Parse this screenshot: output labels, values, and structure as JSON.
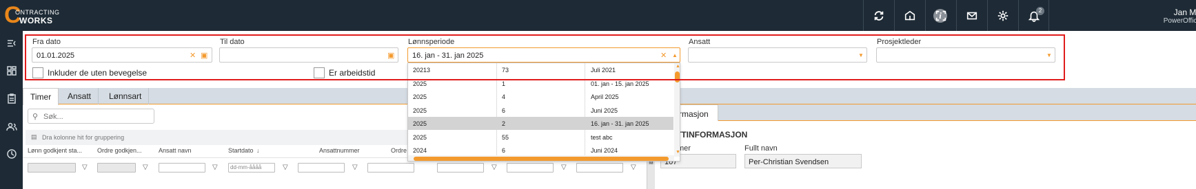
{
  "header": {
    "logo_top": "ONTRACTING",
    "logo_letter": "C",
    "logo_bottom": "WORKS",
    "info_icon": "i",
    "notification_count": "2",
    "user_name": "Jan Mo",
    "user_org": "PowerOffice",
    "icons": [
      "sync-icon",
      "book-icon",
      "fullscreen-icon",
      "mail-icon",
      "gear-icon",
      "bell-icon"
    ]
  },
  "sidebar": {
    "icons": [
      "menu-collapse-icon",
      "dashboard-icon",
      "clipboard-icon",
      "users-icon",
      "clock-icon"
    ]
  },
  "filters": {
    "fra_dato_label": "Fra dato",
    "fra_dato_value": "01.01.2025",
    "til_dato_label": "Til dato",
    "til_dato_value": "",
    "lonnsperiode_label": "Lønnsperiode",
    "lonnsperiode_value": "16. jan - 31. jan 2025",
    "ansatt_label": "Ansatt",
    "ansatt_value": "",
    "prosjektleder_label": "Prosjektleder",
    "prosjektleder_value": "",
    "include_label": "Inkluder de uten bevegelse",
    "arbeidstid_label": "Er arbeidstid"
  },
  "dropdown": {
    "rows": [
      {
        "year": "20213",
        "num": "73",
        "label": "Juli 2021",
        "selected": false
      },
      {
        "year": "2025",
        "num": "1",
        "label": "01. jan - 15. jan 2025",
        "selected": false
      },
      {
        "year": "2025",
        "num": "4",
        "label": "April 2025",
        "selected": false
      },
      {
        "year": "2025",
        "num": "6",
        "label": "Juni 2025",
        "selected": false
      },
      {
        "year": "2025",
        "num": "2",
        "label": "16. jan - 31. jan 2025",
        "selected": true
      },
      {
        "year": "2025",
        "num": "55",
        "label": "test abc",
        "selected": false
      },
      {
        "year": "2024",
        "num": "6",
        "label": "Juni 2024",
        "selected": false
      }
    ]
  },
  "tabs": [
    "Timer",
    "Ansatt",
    "Lønnsart"
  ],
  "search_placeholder": "Søk...",
  "group_hint": "Dra kolonne hit for gruppering",
  "columns": [
    "Lønn godkjent sta...",
    "Ordre godkjen...",
    "Ansatt navn",
    "Startdato",
    "Ansattnummer",
    "Ordre"
  ],
  "date_placeholder": "dd-mm-åååå",
  "right_panel": {
    "tab_label": "rmasjon",
    "heading": "TTINFORMASJON",
    "label_1": "mer",
    "value_1": "107",
    "label_2": "Fullt navn",
    "value_2": "Per-Christian Svendsen",
    "strip_text": "M"
  }
}
